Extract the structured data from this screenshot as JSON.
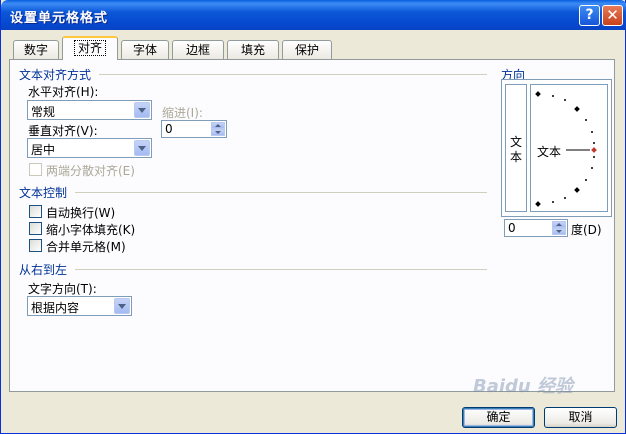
{
  "window": {
    "title": "设置单元格格式"
  },
  "title_buttons": {
    "help": "?",
    "close": "✕"
  },
  "tabs": [
    {
      "label": "数字"
    },
    {
      "label": "对齐"
    },
    {
      "label": "字体"
    },
    {
      "label": "边框"
    },
    {
      "label": "填充"
    },
    {
      "label": "保护"
    }
  ],
  "text_align": {
    "section": "文本对齐方式",
    "horizontal_label": "水平对齐(H):",
    "horizontal_value": "常规",
    "indent_label": "缩进(I):",
    "indent_value": "0",
    "vertical_label": "垂直对齐(V):",
    "vertical_value": "居中",
    "justify_distributed": "两端分散对齐(E)"
  },
  "text_control": {
    "section": "文本控制",
    "wrap": "自动换行(W)",
    "shrink": "缩小字体填充(K)",
    "merge": "合并单元格(M)"
  },
  "rtl": {
    "section": "从右到左",
    "direction_label": "文字方向(T):",
    "direction_value": "根据内容"
  },
  "orientation": {
    "section": "方向",
    "vertical_text": "文本",
    "horizontal_text": "文本",
    "degrees_value": "0",
    "degrees_label": "度(D)"
  },
  "footer": {
    "ok": "确定",
    "cancel": "取消"
  },
  "watermark": "Baidu 经验",
  "colors": {
    "title_bar": "#0054e3",
    "section_title": "#003399",
    "indicator": "#c0392b"
  }
}
